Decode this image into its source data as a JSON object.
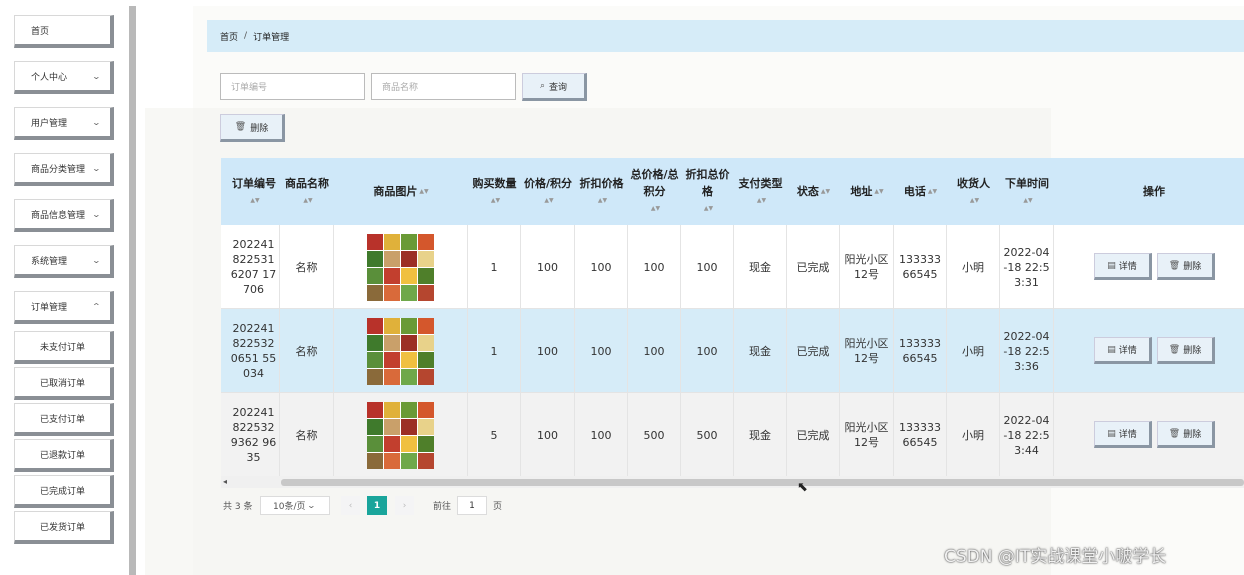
{
  "sidebar": {
    "items": [
      {
        "label": "首页",
        "has_arrow": false
      },
      {
        "label": "个人中心",
        "has_arrow": true
      },
      {
        "label": "用户管理",
        "has_arrow": true
      },
      {
        "label": "商品分类管理",
        "has_arrow": true
      },
      {
        "label": "商品信息管理",
        "has_arrow": true
      },
      {
        "label": "系统管理",
        "has_arrow": true
      },
      {
        "label": "订单管理",
        "has_arrow": true
      }
    ],
    "sub_items": [
      "未支付订单",
      "已取消订单",
      "已支付订单",
      "已退款订单",
      "已完成订单",
      "已发货订单"
    ],
    "arrow_icon": "chevron-down-icon"
  },
  "breadcrumb": {
    "home": "首页",
    "separator": "/",
    "current": "订单管理"
  },
  "search": {
    "order_no_placeholder": "订单编号",
    "product_name_placeholder": "商品名称",
    "query_label": "查询",
    "query_icon": "search-icon"
  },
  "toolbar": {
    "delete_label": "删除",
    "delete_icon": "trash-icon"
  },
  "table": {
    "columns": [
      "订单编号",
      "商品名称",
      "商品图片",
      "购买数量",
      "价格/积分",
      "折扣价格",
      "总价格/总积分",
      "折扣总价格",
      "支付类型",
      "状态",
      "地址",
      "电话",
      "收货人",
      "下单时间",
      "操作"
    ],
    "rows": [
      {
        "order_no": "2022418225316207 17706",
        "product_name": "名称",
        "image": "vegetables-photo",
        "quantity": "1",
        "price": "100",
        "discount_price": "100",
        "total": "100",
        "discount_total": "100",
        "pay_type": "现金",
        "status": "已完成",
        "address": "阳光小区12号",
        "phone": "13333366545",
        "receiver": "小明",
        "time": "2022-04-18 22:53:31"
      },
      {
        "order_no": "2022418225320651 55034",
        "product_name": "名称",
        "image": "vegetables-photo",
        "quantity": "1",
        "price": "100",
        "discount_price": "100",
        "total": "100",
        "discount_total": "100",
        "pay_type": "现金",
        "status": "已完成",
        "address": "阳光小区12号",
        "phone": "13333366545",
        "receiver": "小明",
        "time": "2022-04-18 22:53:36"
      },
      {
        "order_no": "2022418225329362 9635",
        "product_name": "名称",
        "image": "vegetables-photo",
        "quantity": "5",
        "price": "100",
        "discount_price": "100",
        "total": "500",
        "discount_total": "500",
        "pay_type": "现金",
        "status": "已完成",
        "address": "阳光小区12号",
        "phone": "13333366545",
        "receiver": "小明",
        "time": "2022-04-18 22:53:44"
      }
    ],
    "detail_label": "详情",
    "detail_icon": "document-icon",
    "delete_label": "删除",
    "delete_icon": "trash-icon",
    "sort_icon": "sort-caret-icon"
  },
  "pagination": {
    "total": "共 3 条",
    "page_size": "10条/页",
    "current_page": "1",
    "goto_label": "前往",
    "goto_value": "1",
    "page_suffix": "页"
  },
  "watermark": "CSDN @IT实战课堂小啵学长",
  "colors": {
    "header_bg": "#cfe8f9",
    "active_page": "#1aa59b",
    "highlight_row": "#d6ecf8"
  }
}
